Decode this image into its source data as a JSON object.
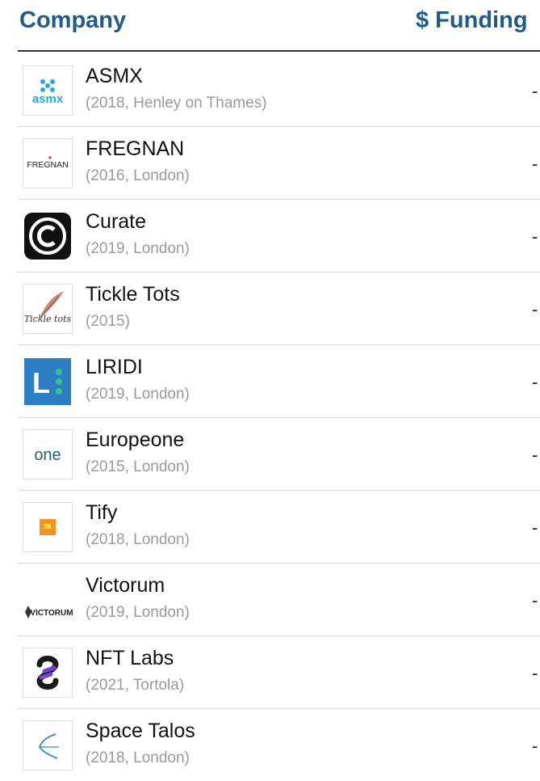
{
  "header": {
    "company_label": "Company",
    "funding_label": "$ Funding"
  },
  "rows": [
    {
      "name": "ASMX",
      "meta": "(2018, Henley on Thames)",
      "funding": "-",
      "logo_text": "asmx",
      "logo_icon": "asmx-logo-icon"
    },
    {
      "name": "FREGNAN",
      "meta": "(2016, London)",
      "funding": "-",
      "logo_text": "FREGNAN",
      "logo_icon": "fregnan-logo-icon"
    },
    {
      "name": "Curate",
      "meta": "(2019, London)",
      "funding": "-",
      "logo_text": "",
      "logo_icon": "curate-logo-icon"
    },
    {
      "name": "Tickle Tots",
      "meta": "(2015)",
      "funding": "-",
      "logo_text": "Tickle tots",
      "logo_icon": "tickle-tots-logo-icon"
    },
    {
      "name": "LIRIDI",
      "meta": "(2019, London)",
      "funding": "-",
      "logo_text": "L",
      "logo_icon": "liridi-logo-icon"
    },
    {
      "name": "Europeone",
      "meta": "(2015, London)",
      "funding": "-",
      "logo_text": "one",
      "logo_icon": "europeone-logo-icon"
    },
    {
      "name": "Tify",
      "meta": "(2018, London)",
      "funding": "-",
      "logo_text": "",
      "logo_icon": "tify-logo-icon"
    },
    {
      "name": "Victorum",
      "meta": "(2019, London)",
      "funding": "-",
      "logo_text": "VICTORUM",
      "logo_icon": "victorum-logo-icon"
    },
    {
      "name": "NFT Labs",
      "meta": "(2021, Tortola)",
      "funding": "-",
      "logo_text": "",
      "logo_icon": "nft-labs-logo-icon"
    },
    {
      "name": "Space Talos",
      "meta": "(2018, London)",
      "funding": "-",
      "logo_text": "",
      "logo_icon": "space-talos-logo-icon"
    }
  ]
}
